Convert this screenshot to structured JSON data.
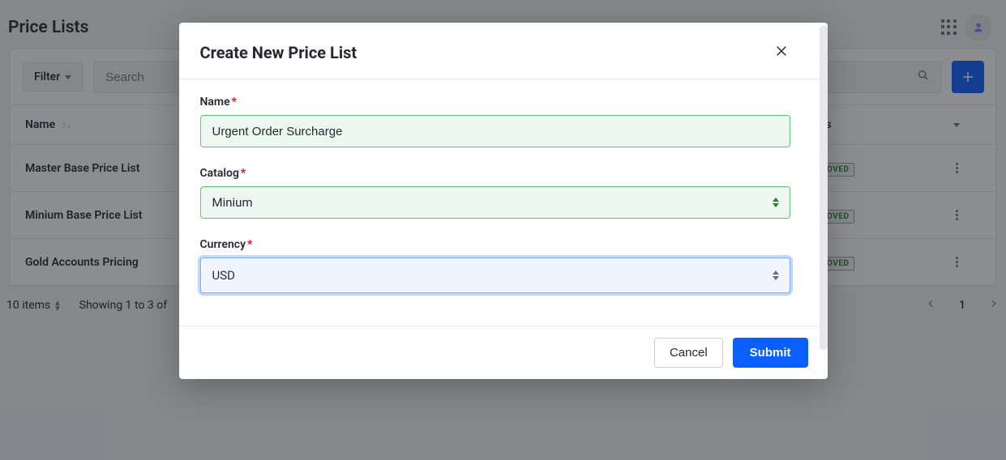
{
  "page": {
    "title": "Price Lists"
  },
  "toolbar": {
    "filter_label": "Filter",
    "search_placeholder": "Search"
  },
  "table": {
    "columns": {
      "name": "Name",
      "status": "Status"
    },
    "rows": [
      {
        "name": "Master Base Price List",
        "status": "APPROVED"
      },
      {
        "name": "Minium Base Price List",
        "status": "APPROVED"
      },
      {
        "name": "Gold Accounts Pricing",
        "status": "APPROVED"
      }
    ]
  },
  "footer": {
    "per_page": "10 items",
    "showing": "Showing 1 to 3 of",
    "page": "1"
  },
  "modal": {
    "title": "Create New Price List",
    "fields": {
      "name": {
        "label": "Name",
        "value": "Urgent Order Surcharge"
      },
      "catalog": {
        "label": "Catalog",
        "value": "Minium"
      },
      "currency": {
        "label": "Currency",
        "value": "USD"
      }
    },
    "cancel": "Cancel",
    "submit": "Submit"
  }
}
